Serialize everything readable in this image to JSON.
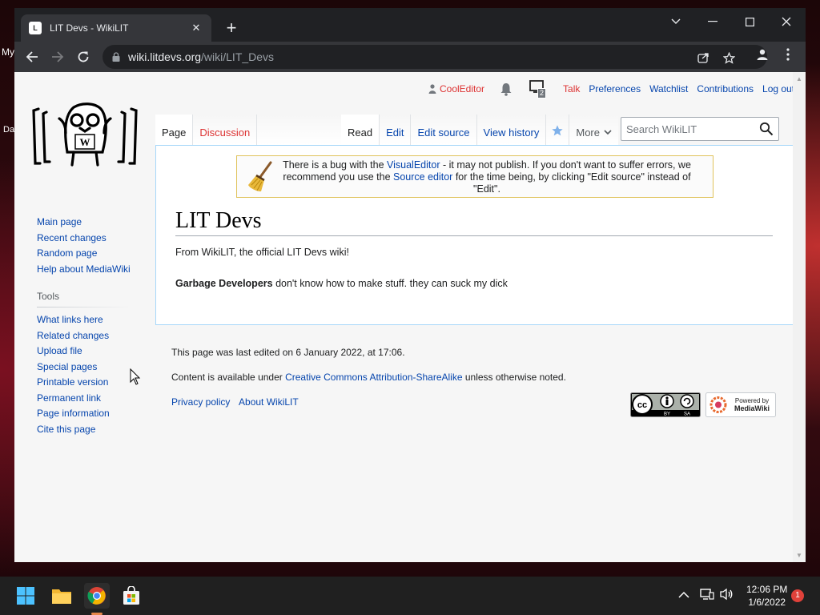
{
  "desktop": {
    "left_labels": [
      "My",
      "Da"
    ]
  },
  "browser": {
    "tab_title": "LIT Devs - WikiLIT",
    "tab_favicon_text": "L",
    "url_host": "wiki.litdevs.org",
    "url_path": "/wiki/LIT_Devs"
  },
  "user_menu": {
    "username": "CoolEditor",
    "notification_count": "2",
    "talk": "Talk",
    "preferences": "Preferences",
    "watchlist": "Watchlist",
    "contributions": "Contributions",
    "logout": "Log out"
  },
  "logo_letter": "W",
  "sidebar": {
    "nav": [
      "Main page",
      "Recent changes",
      "Random page",
      "Help about MediaWiki"
    ],
    "tools_heading": "Tools",
    "tools": [
      "What links here",
      "Related changes",
      "Upload file",
      "Special pages",
      "Printable version",
      "Permanent link",
      "Page information",
      "Cite this page"
    ]
  },
  "tabs": {
    "page": "Page",
    "discussion": "Discussion",
    "read": "Read",
    "edit": "Edit",
    "edit_source": "Edit source",
    "view_history": "View history",
    "more": "More"
  },
  "search": {
    "placeholder": "Search WikiLIT"
  },
  "notice": {
    "part1": "There is a bug with the ",
    "link1": "VisualEditor",
    "part2": " - it may not publish. If you don't want to suffer errors, we recommend you use the ",
    "link2": "Source editor",
    "part3": " for the time being, by clicking \"Edit source\" instead of \"Edit\"."
  },
  "article": {
    "title": "LIT Devs",
    "tagline": "From WikiLIT, the official LIT Devs wiki!",
    "body_bold": "Garbage Developers",
    "body_rest": " don't know how to make stuff. they can suck my dick"
  },
  "footer": {
    "last_edited": "This page was last edited on 6 January 2022, at 17:06.",
    "license_prefix": "Content is available under ",
    "license_link": "Creative Commons Attribution-ShareAlike",
    "license_suffix": " unless otherwise noted.",
    "privacy": "Privacy policy",
    "about": "About WikiLIT",
    "powered_by_line1": "Powered by",
    "powered_by_line2": "MediaWiki"
  },
  "taskbar": {
    "time": "12:06 PM",
    "date": "1/6/2022",
    "notification_badge": "1"
  },
  "colors": {
    "link": "#0645ad",
    "red_link": "#d33",
    "chrome_dark": "#202124",
    "chrome_toolbar": "#35363a"
  }
}
